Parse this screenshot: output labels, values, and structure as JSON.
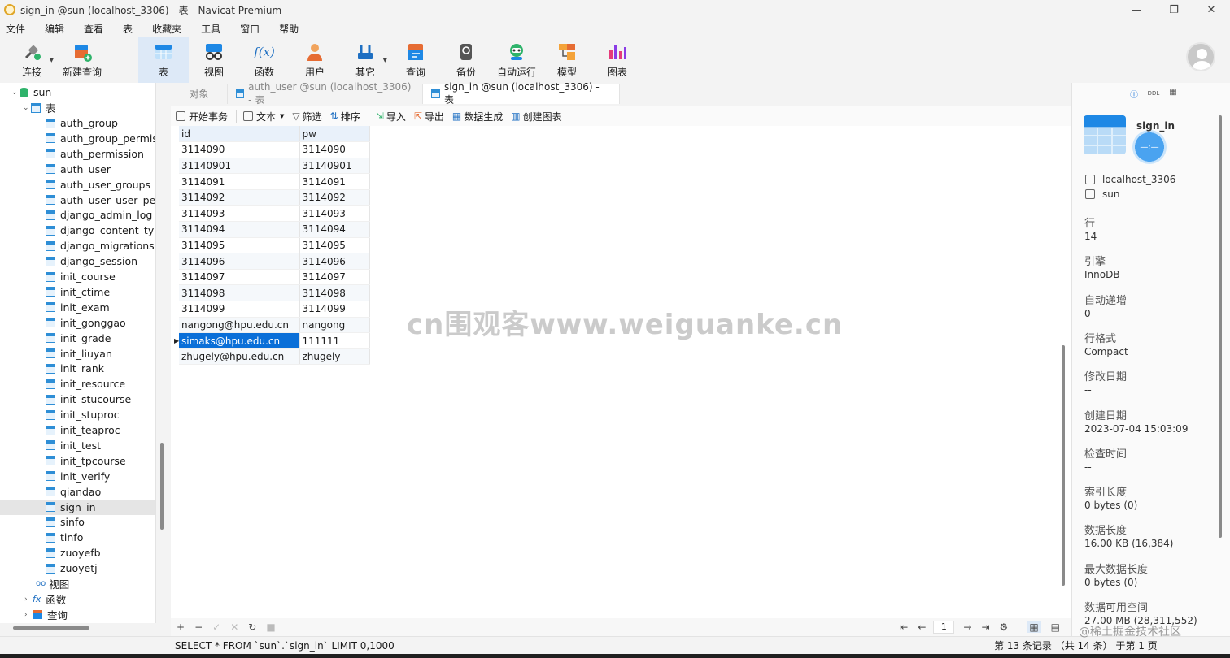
{
  "window": {
    "title": "sign_in @sun (localhost_3306) - 表 - Navicat Premium",
    "minimize": "—",
    "maximize": "❐",
    "close": "✕"
  },
  "menu": [
    "文件",
    "编辑",
    "查看",
    "表",
    "收藏夹",
    "工具",
    "窗口",
    "帮助"
  ],
  "toolbar": {
    "connect": "连接",
    "new_query": "新建查询",
    "table": "表",
    "view": "视图",
    "function": "函数",
    "user": "用户",
    "other": "其它",
    "query": "查询",
    "backup": "备份",
    "automation": "自动运行",
    "model": "模型",
    "chart": "图表",
    "function_glyph": "f(x)"
  },
  "sidebar": {
    "database": "sun",
    "tables_label": "表",
    "tables": [
      "auth_group",
      "auth_group_permiss",
      "auth_permission",
      "auth_user",
      "auth_user_groups",
      "auth_user_user_perm",
      "django_admin_log",
      "django_content_type",
      "django_migrations",
      "django_session",
      "init_course",
      "init_ctime",
      "init_exam",
      "init_gonggao",
      "init_grade",
      "init_liuyan",
      "init_rank",
      "init_resource",
      "init_stucourse",
      "init_stuproc",
      "init_teaproc",
      "init_test",
      "init_tpcourse",
      "init_verify",
      "qiandao",
      "sign_in",
      "sinfo",
      "tinfo",
      "zuoyefb",
      "zuoyetj"
    ],
    "selected": "sign_in",
    "views_label": "视图",
    "functions_label": "函数",
    "queries_label": "查询"
  },
  "tabs": {
    "objects": "对象",
    "tab1": "auth_user @sun (localhost_3306) - 表",
    "tab2": "sign_in @sun (localhost_3306) - 表"
  },
  "data_toolbar": {
    "begin_tx": "开始事务",
    "text": "文本",
    "filter": "筛选",
    "sort": "排序",
    "import": "导入",
    "export": "导出",
    "generate": "数据生成",
    "create_chart": "创建图表"
  },
  "grid": {
    "columns": [
      "id",
      "pw"
    ],
    "rows": [
      [
        "3114090",
        "3114090"
      ],
      [
        "31140901",
        "31140901"
      ],
      [
        "3114091",
        "3114091"
      ],
      [
        "3114092",
        "3114092"
      ],
      [
        "3114093",
        "3114093"
      ],
      [
        "3114094",
        "3114094"
      ],
      [
        "3114095",
        "3114095"
      ],
      [
        "3114096",
        "3114096"
      ],
      [
        "3114097",
        "3114097"
      ],
      [
        "3114098",
        "3114098"
      ],
      [
        "3114099",
        "3114099"
      ],
      [
        "nangong@hpu.edu.cn",
        "nangong"
      ],
      [
        "simaks@hpu.edu.cn",
        "111111"
      ],
      [
        "zhugely@hpu.edu.cn",
        "zhugely"
      ]
    ],
    "selected_row": 12,
    "row_marker": "▶"
  },
  "watermark": "cn围观客www.weiguanke.cn",
  "bottom_bar": {
    "add": "+",
    "remove": "−",
    "apply": "✓",
    "discard": "✕",
    "refresh": "↻",
    "stop": "■",
    "first": "⇤",
    "prev": "←",
    "page": "1",
    "next": "→",
    "last": "⇥",
    "settings": "⚙",
    "grid_view": "▦",
    "form_view": "▤"
  },
  "status": {
    "sql": "SELECT * FROM `sun`.`sign_in` LIMIT 0,1000",
    "records": "第 13 条记录 （共 14 条） 于第 1 页"
  },
  "info": {
    "name": "sign_in",
    "connection": "localhost_3306",
    "database": "sun",
    "fields": [
      {
        "label": "行",
        "value": "14"
      },
      {
        "label": "引擎",
        "value": "InnoDB"
      },
      {
        "label": "自动递增",
        "value": "0"
      },
      {
        "label": "行格式",
        "value": "Compact"
      },
      {
        "label": "修改日期",
        "value": "--"
      },
      {
        "label": "创建日期",
        "value": "2023-07-04 15:03:09"
      },
      {
        "label": "检查时间",
        "value": "--"
      },
      {
        "label": "索引长度",
        "value": "0 bytes (0)"
      },
      {
        "label": "数据长度",
        "value": "16.00 KB (16,384)"
      },
      {
        "label": "最大数据长度",
        "value": "0 bytes (0)"
      },
      {
        "label": "数据可用空间",
        "value": "27.00 MB (28,311,552)"
      }
    ],
    "tab_info": "ⓘ",
    "tab_ddl": "DDL",
    "tab_grid": "▦"
  },
  "credit": "@稀土掘金技术社区",
  "colors": {
    "accent": "#0a6fd8",
    "selected_sidebar": "#e5e5e5",
    "header": "#e9f1fa"
  }
}
